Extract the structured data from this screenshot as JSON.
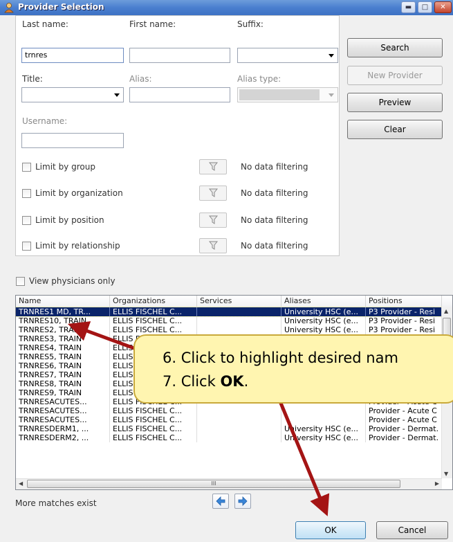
{
  "window": {
    "title": "Provider Selection",
    "min_label": "▬",
    "max_label": "□",
    "close_label": "✕"
  },
  "form": {
    "last_name_label": "Last name:",
    "last_name_value": "trnres",
    "first_name_label": "First name:",
    "suffix_label": "Suffix:",
    "title_label": "Title:",
    "alias_label": "Alias:",
    "alias_type_label": "Alias type:",
    "username_label": "Username:"
  },
  "buttons": {
    "search": "Search",
    "new_provider": "New Provider",
    "preview": "Preview",
    "clear": "Clear",
    "ok": "OK",
    "cancel": "Cancel"
  },
  "filters": [
    {
      "label": "Limit by group",
      "status": "No data filtering"
    },
    {
      "label": "Limit by organization",
      "status": "No data filtering"
    },
    {
      "label": "Limit by position",
      "status": "No data filtering"
    },
    {
      "label": "Limit by relationship",
      "status": "No data filtering"
    }
  ],
  "view_physicians_label": "View physicians only",
  "grid": {
    "columns": [
      "Name",
      "Organizations",
      "Services",
      "Aliases",
      "Positions"
    ],
    "rows": [
      [
        "TRNRES1 MD, TR...",
        "ELLIS FISCHEL C...",
        "",
        "University HSC (e...",
        "P3 Provider - Resi"
      ],
      [
        "TRNRES10, TRAIN",
        "ELLIS FISCHEL C...",
        "",
        "University HSC (e...",
        "P3 Provider - Resi"
      ],
      [
        "TRNRES2, TRAIN",
        "ELLIS FISCHEL C...",
        "",
        "University HSC (e...",
        "P3 Provider - Resi"
      ],
      [
        "TRNRES3, TRAIN",
        "ELLIS FISCHEL C...",
        "",
        "",
        ""
      ],
      [
        "TRNRES4, TRAIN",
        "ELLIS FISCHEL C...",
        "",
        "",
        ""
      ],
      [
        "TRNRES5, TRAIN",
        "ELLIS FISCHEL C...",
        "",
        "",
        ""
      ],
      [
        "TRNRES6, TRAIN",
        "ELLIS FISCHEL C...",
        "",
        "",
        ""
      ],
      [
        "TRNRES7, TRAIN",
        "ELLIS FISCHEL C...",
        "",
        "",
        ""
      ],
      [
        "TRNRES8, TRAIN",
        "ELLIS FISCHEL C...",
        "",
        "",
        ""
      ],
      [
        "TRNRES9, TRAIN",
        "ELLIS FISCHEL C...",
        "",
        "",
        ""
      ],
      [
        "TRNRESACUTES...",
        "ELLIS FISCHEL C...",
        "",
        "",
        "Provider - Acute C"
      ],
      [
        "TRNRESACUTES...",
        "ELLIS FISCHEL C...",
        "",
        "",
        "Provider - Acute C"
      ],
      [
        "TRNRESACUTES...",
        "ELLIS FISCHEL C...",
        "",
        "",
        "Provider - Acute C"
      ],
      [
        "TRNRESDERM1, ...",
        "ELLIS FISCHEL C...",
        "",
        "University HSC (e...",
        "Provider - Dermat."
      ],
      [
        "TRNRESDERM2, ...",
        "ELLIS FISCHEL C...",
        "",
        "University HSC (e...",
        "Provider - Dermat."
      ]
    ],
    "hscroll_grip": "III"
  },
  "more_matches": "More matches exist",
  "callout": {
    "step6": "6.  Click to highlight desired nam",
    "step7_prefix": "7.  Click ",
    "step7_bold": "OK",
    "step7_suffix": "."
  },
  "colors": {
    "arrow": "#a41414",
    "callout_fill": "#fff5b0",
    "selection": "#0a246a"
  }
}
